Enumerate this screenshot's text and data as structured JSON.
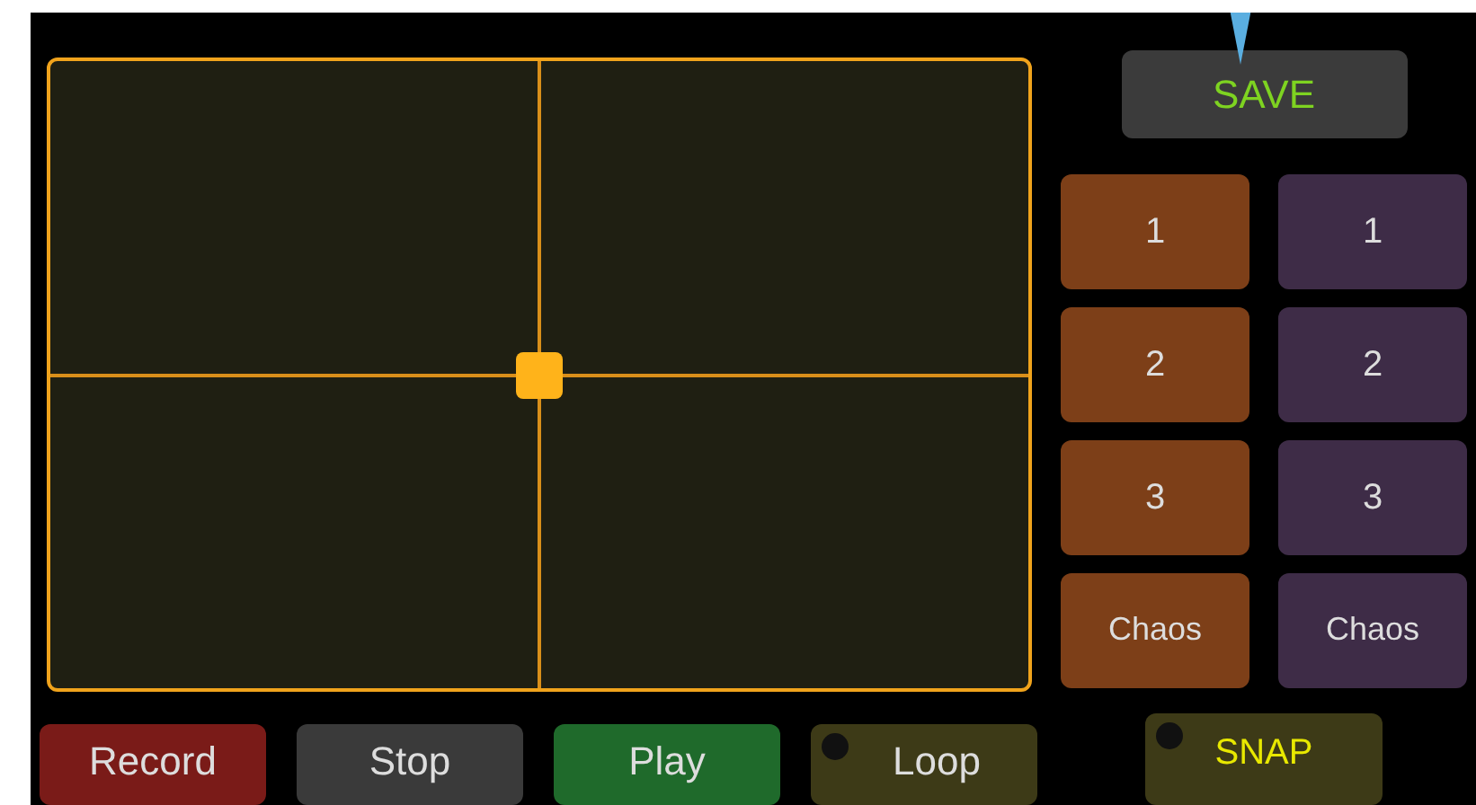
{
  "save_button": {
    "label": "SAVE"
  },
  "preset_columns": [
    {
      "color": "#7d3f18",
      "presets": [
        "1",
        "2",
        "3",
        "Chaos"
      ]
    },
    {
      "color": "#3e2c47",
      "presets": [
        "1",
        "2",
        "3",
        "Chaos"
      ]
    }
  ],
  "transport": [
    {
      "kind": "button",
      "label": "Record",
      "color": "#7a1b18"
    },
    {
      "kind": "button",
      "label": "Stop",
      "color": "#3a3a3a"
    },
    {
      "kind": "button",
      "label": "Play",
      "color": "#1f6a2b"
    },
    {
      "kind": "toggle",
      "label": "Loop",
      "color": "#3d3a17",
      "on": false
    }
  ],
  "snap": {
    "label": "SNAP",
    "on": false
  }
}
